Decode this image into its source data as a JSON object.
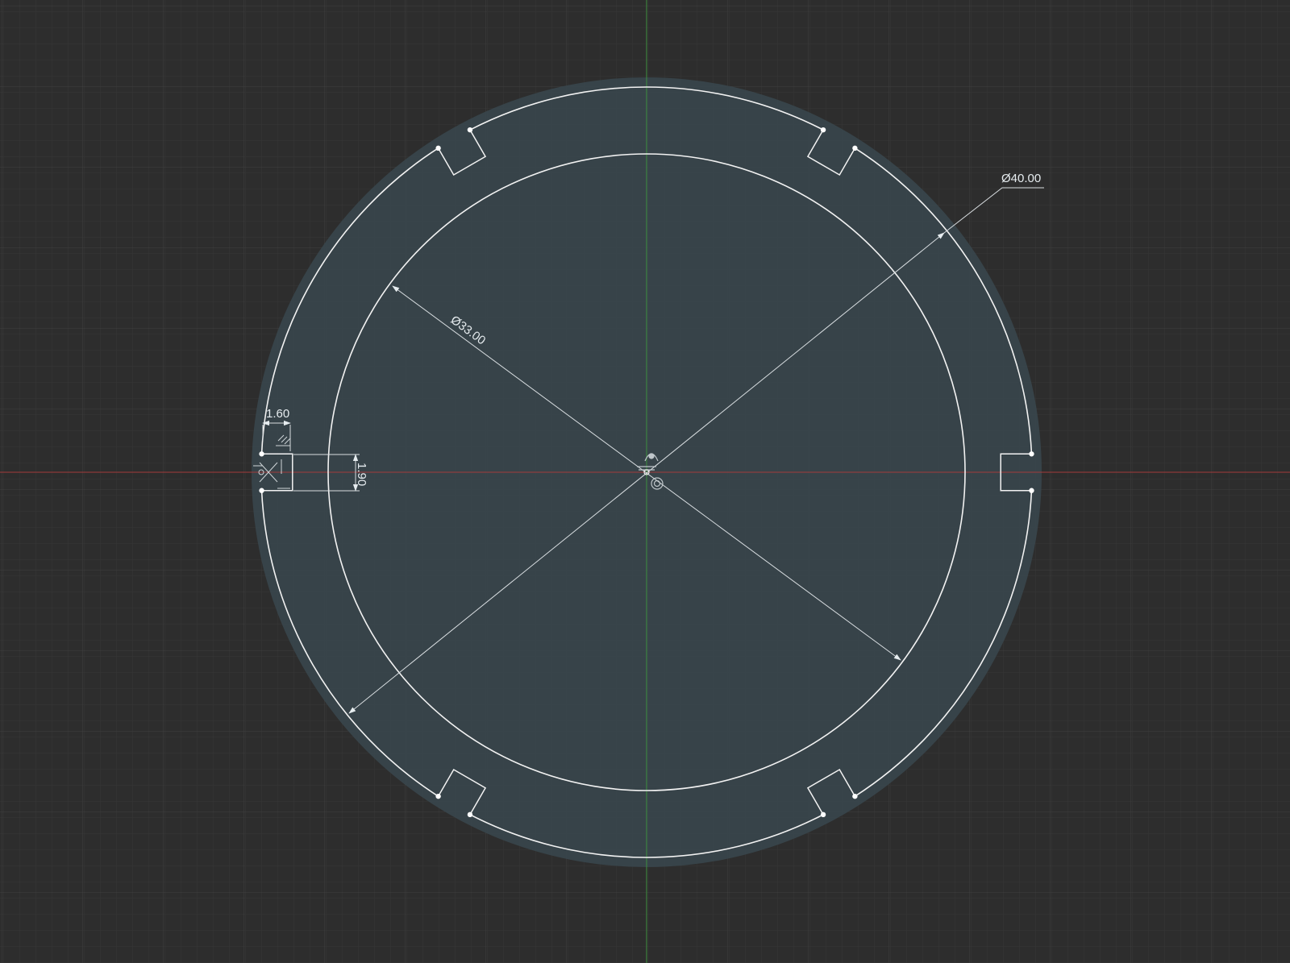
{
  "sketch": {
    "units": "mm",
    "outer_circle_diameter": 40.0,
    "inner_circle_diameter": 33.0,
    "notch_count": 6,
    "notch_width": 1.9,
    "notch_depth": 1.6
  },
  "dimensions": {
    "outer_diameter_label": "Ø40.00",
    "inner_diameter_label": "Ø33.00",
    "notch_depth_label": "1.60",
    "notch_width_label": "1.90"
  },
  "colors": {
    "background": "#2d2d2d",
    "grid_minor": "#383838",
    "grid_major": "#424242",
    "profile_fill": "#3c474d",
    "sketch_line": "#f2f2f2",
    "x_axis": "#a33b3b",
    "y_axis": "#3e8f3e",
    "dimension_line": "#d8dde0"
  }
}
